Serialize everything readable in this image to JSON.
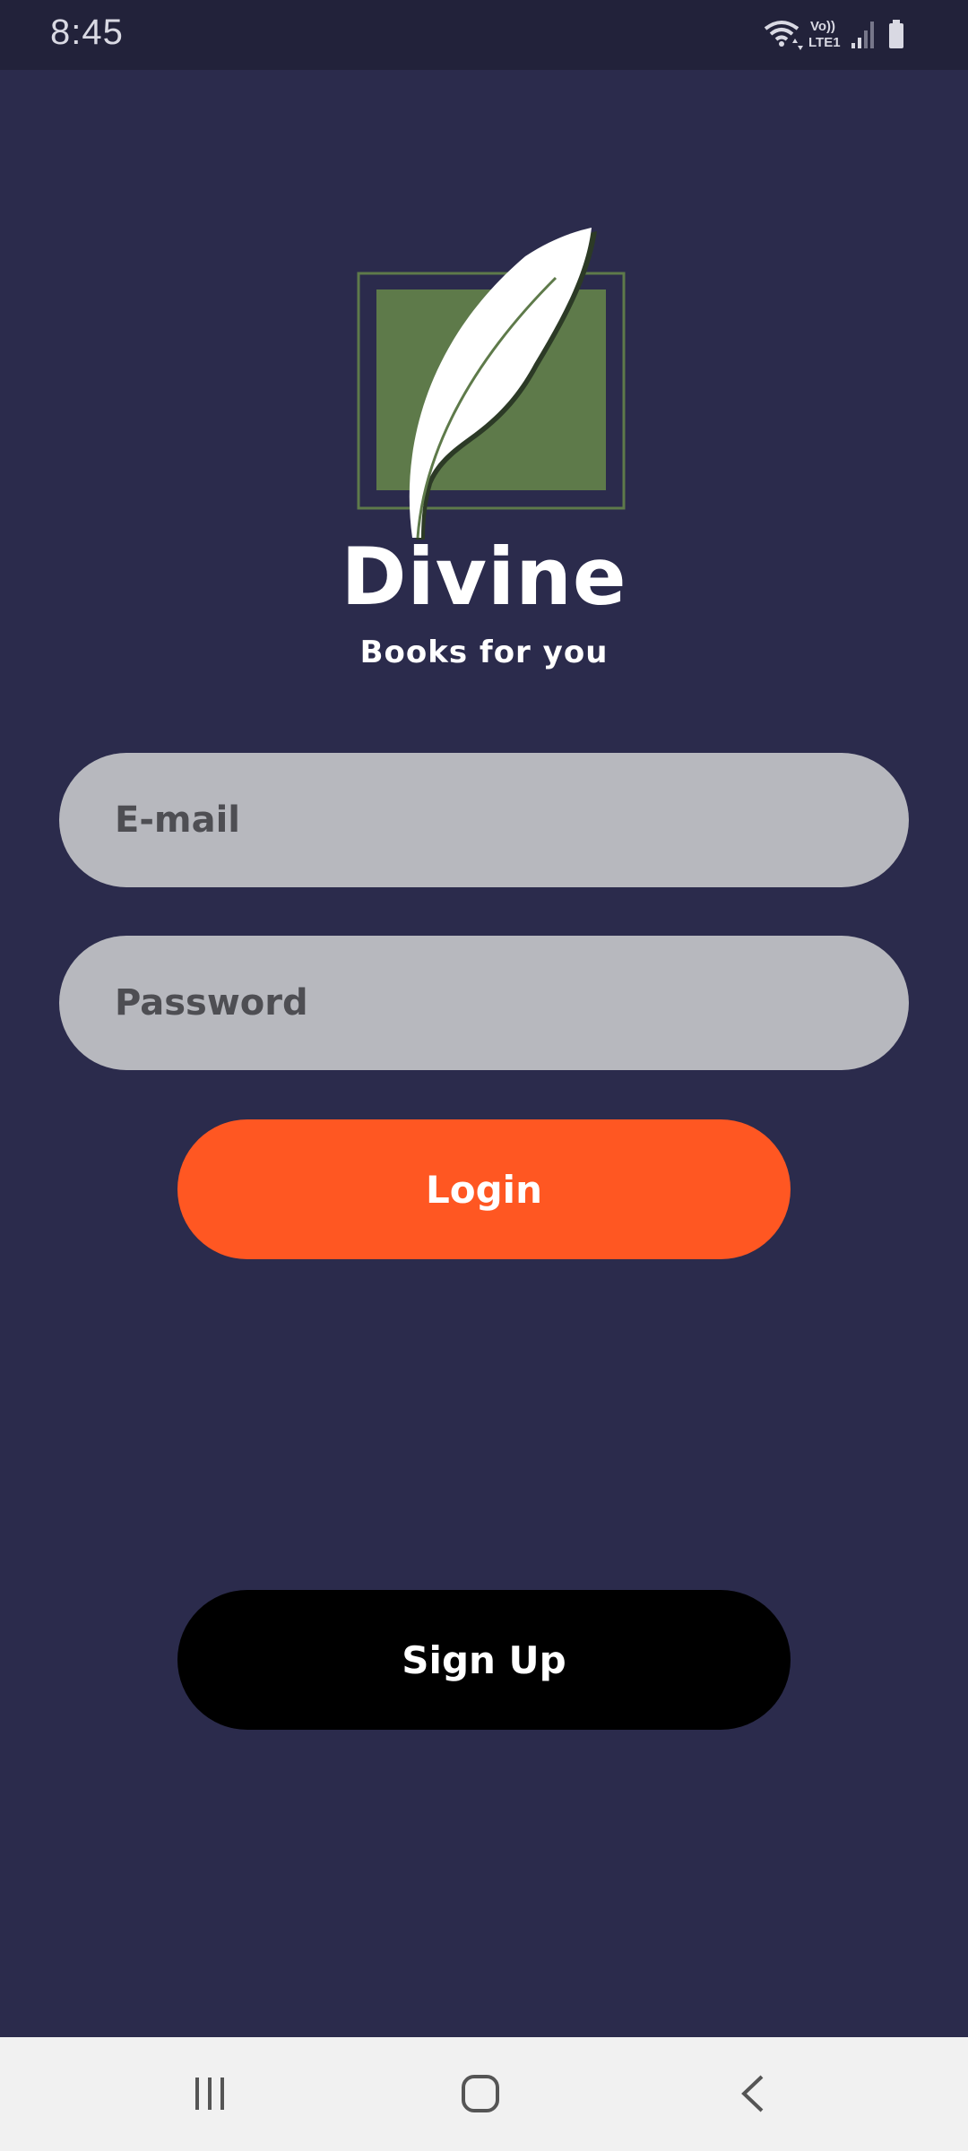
{
  "status_bar": {
    "time": "8:45",
    "network_label_top": "Vo))",
    "network_label_bottom": "LTE1",
    "icons": [
      "wifi-icon",
      "signal-icon",
      "battery-icon"
    ]
  },
  "brand": {
    "name": "Divine",
    "tagline": "Books for you"
  },
  "form": {
    "email_placeholder": "E-mail",
    "password_placeholder": "Password",
    "login_label": "Login",
    "signup_label": "Sign Up"
  },
  "nav_bar": {
    "icons": [
      "recents-icon",
      "home-icon",
      "back-icon"
    ]
  },
  "colors": {
    "background": "#2b2b4c",
    "status_bar": "#22223a",
    "input_background": "#b7b8be",
    "login_button": "#ff5722",
    "signup_button": "#000000",
    "logo_green": "#5e7a4a"
  }
}
